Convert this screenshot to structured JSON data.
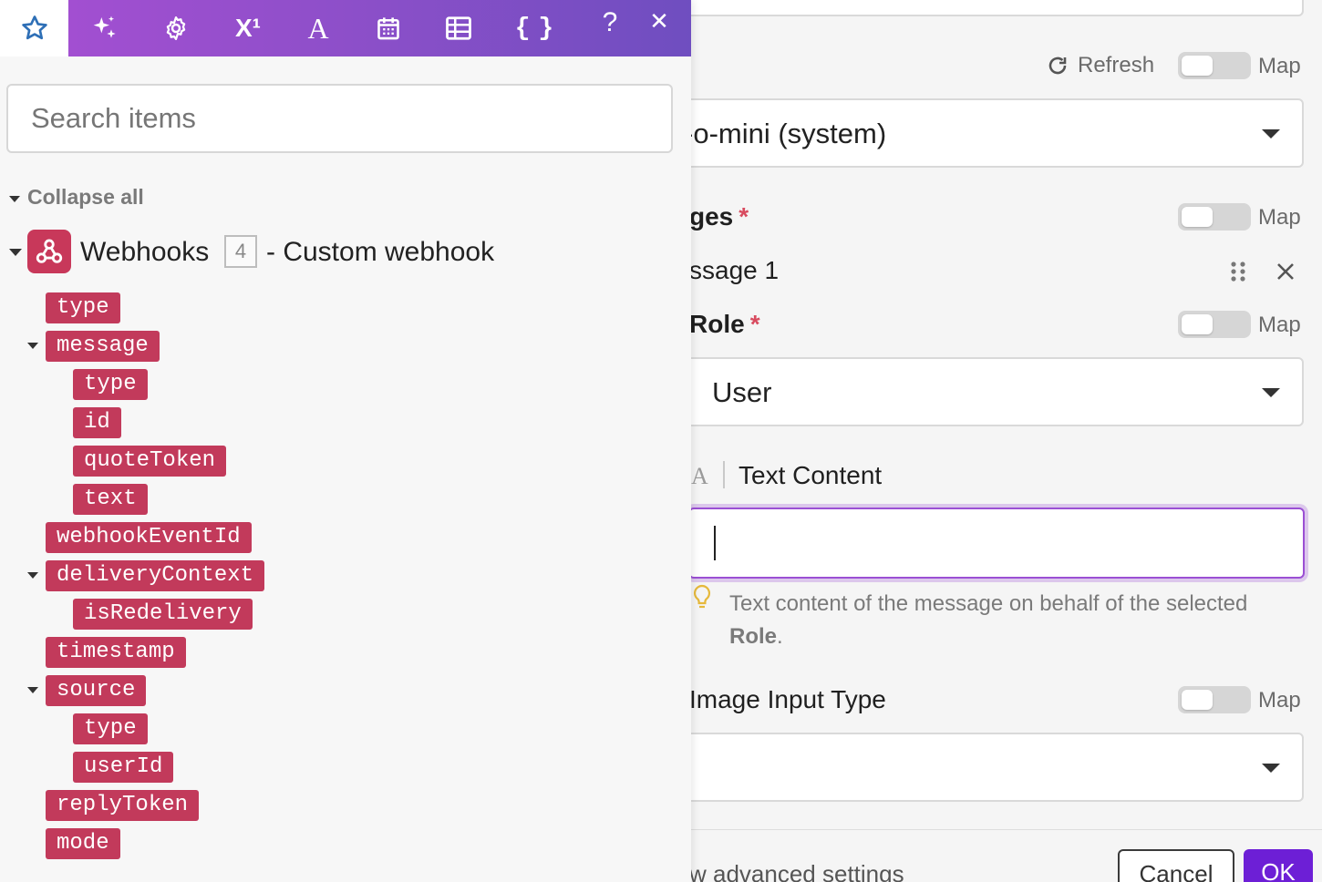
{
  "toolbar": {
    "tools": [
      {
        "name": "star-icon"
      },
      {
        "name": "sparkles-icon"
      },
      {
        "name": "gear-icon"
      },
      {
        "name": "superscript-icon",
        "label": "X¹"
      },
      {
        "name": "text-format-icon",
        "label": "A"
      },
      {
        "name": "calendar-icon"
      },
      {
        "name": "table-icon"
      },
      {
        "name": "braces-icon",
        "label": "{ }"
      },
      {
        "name": "help-icon",
        "label": "?"
      },
      {
        "name": "close-icon",
        "label": "✕"
      }
    ],
    "colors": {
      "gradient_start": "#a24fd1",
      "gradient_end": "#6f4ec0",
      "star": "#2e6fb6"
    }
  },
  "search": {
    "placeholder": "Search items",
    "value": ""
  },
  "tree": {
    "collapse_all_label": "Collapse all",
    "module": {
      "name": "Webhooks",
      "number": "4",
      "suffix": "- Custom webhook",
      "icon": "webhook-icon",
      "color": "#c8385a"
    },
    "items": [
      {
        "label": "type",
        "expandable": false
      },
      {
        "label": "message",
        "expandable": true
      },
      {
        "label": "type",
        "expandable": false
      },
      {
        "label": "id",
        "expandable": false
      },
      {
        "label": "quoteToken",
        "expandable": false
      },
      {
        "label": "text",
        "expandable": false
      },
      {
        "label": "webhookEventId",
        "expandable": false
      },
      {
        "label": "deliveryContext",
        "expandable": true
      },
      {
        "label": "isRedelivery",
        "expandable": false
      },
      {
        "label": "timestamp",
        "expandable": false
      },
      {
        "label": "source",
        "expandable": true
      },
      {
        "label": "type",
        "expandable": false
      },
      {
        "label": "userId",
        "expandable": false
      },
      {
        "label": "replyToken",
        "expandable": false
      },
      {
        "label": "mode",
        "expandable": false
      }
    ],
    "pill_color": "#c23a5b"
  },
  "form": {
    "refresh_label": "Refresh",
    "map_label": "Map",
    "model_value": "-o-mini (system)",
    "messages_label": "ges",
    "message_item_label": "ssage 1",
    "role_label": "Role",
    "role_value": "User",
    "text_content_icon": "A",
    "text_content_label": "Text Content",
    "text_content_value": "",
    "hint_text": "Text content of the message on behalf of the selected",
    "hint_bold": "Role",
    "hint_end": ".",
    "image_input_label": "Image Input Type",
    "image_input_value": "",
    "advanced_label": "w advanced settings",
    "cancel_label": "Cancel",
    "ok_label": "OK",
    "required_mark": "*"
  }
}
